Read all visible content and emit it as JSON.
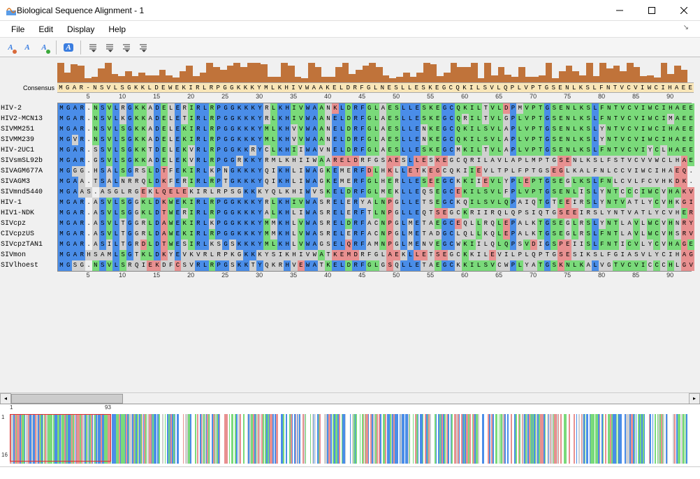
{
  "window": {
    "title": "Biological Sequence Alignment - 1"
  },
  "menu": {
    "file": "File",
    "edit": "Edit",
    "display": "Display",
    "help": "Help"
  },
  "ruler": {
    "ticks": [
      5,
      10,
      15,
      20,
      25,
      30,
      35,
      40,
      45,
      50,
      55,
      60,
      65,
      70,
      75,
      80,
      85,
      90
    ]
  },
  "consensus": {
    "label": "Consensus",
    "sequence": "MGAR-NSVLSGKKLDEWEKIRLRPGGKKKYMLKHIVWAAKELDRFGLNESLLESKEGCQKILSVLQPLVPTGSENLKSLFNTVCVIWCIHAEE"
  },
  "sequences": [
    {
      "name": "HIV-2",
      "seq": "MGAR.NSVLRGKKADELERIRLRPGGKKKYRLKHIVWAANKLDRFGLAESLLESKEGCQKILTVLDPMVPTGSENLKSLFNTVCVIWCIHAEE"
    },
    {
      "name": "HIV2-MCN13",
      "seq": "MGAR.NSVLKGKKADELETIRLRPGGKKKYRLKHIVWAANELDRFGLAESLLESKEGCQRILTVLGPLVPTGSENLKSLFNTVCVIWCIMAEE"
    },
    {
      "name": "SIVMM251",
      "seq": "MGAR.NSVLSGKKADELEKIRLRPGGKKKYMLKHVVWAANELDRFGLAESLLENKEGCQKILSVLAPLVPTGSENLKSLYNTVCVIWCIHAEE"
    },
    {
      "name": "SIVMM239",
      "seq": "MGVR.NSVLSGKKADELEKIRLRPGGKKKYMLKHVVWAANELDRFGLAESLLENKEGCQKILSVLAPLVPTGSENLKSLYNTVCVIWCIHAEE"
    },
    {
      "name": "HIV-2UC1",
      "seq": "MGAR.SSVLSGKKTDELEKVRLRPGGKKRYCLKHIIWAVNELDRFGLAESLLESKEGCMKILTVLAPLVPTGSENLKSLFNTVCVIYCLHAEE"
    },
    {
      "name": "SIVsmSL92b",
      "seq": "MGAR.GSVLSGKKADELEKVRLRPGGRKKYRMLKHIIWAARELDRFGSAESLLESKEGCQRILAVLAPLMPTGSENLKSLFSTVCVVWCLHAEM"
    },
    {
      "name": "SIVAGM677A",
      "seq": "MGGG.HSALSGRSLDTFEKIRLKPNGKKKYQIKHLIWAGKEMERFDLHKLLETKEGCQKIIEVLTPLFPTGSEGLKALFNLCCVIWCIHAEQ"
    },
    {
      "name": "SIVAGM3",
      "seq": "MGAA.TSALNRRQLDKFERIRLRPTGKKKYQIKHLIWAGKEMERFGLHERLLESEEGCKKIIEVLYPLEPTGSEGLKSLFNLCVLFCVHKDK"
    },
    {
      "name": "SIVmnd5440",
      "seq": "MGAAS.ASGLRGEKLQELEKIRLRPSGKKKYQLKHIWVSKELDRFGLMEKLLEQSEGCEKILSVLFPLVPTGSENLISLYNTCCCIWCVHAKV"
    },
    {
      "name": "HIV-1",
      "seq": "MGAR.ASVLSGGKLDKWEKIRLRPGGKKKYRLKHIVWASRELERYALNPGLLETSEGCKQILSVLQPAIQTGTEEIRSLYNTVATLYCVHKGI"
    },
    {
      "name": "HIV1-NDK",
      "seq": "MGAR.ASVLSGGKLDTWERIRLRPGGKKKYALKHLIWASRELERFTLNPGLLEQTSEGCKRIIRQLQPSIQTGSEEIRSLYNTVATLYCVHERI"
    },
    {
      "name": "SIVcpz",
      "seq": "MGAR.ASVLTGGRLDAWEKIRLKPGGKKKYMMKHLVWASRELDRFACNPGLMETAEGCEQLLRQLEPALKTGSEGLRSLYNTLAVLWCVHNRY"
    },
    {
      "name": "CIVcpzUS",
      "seq": "MGAR.ASVLTGGRLDAWEKIRLRPGGKKKYMMKHLVWASRELERFACNPGLMETADGCLQLLKQLEPALKTGSEGLRSLFNTLAVLWCVHSRV"
    },
    {
      "name": "SIVcpzTAN1",
      "seq": "MGAR.ASILTGRDLDTWESIRLKSGSKKKYMLKHLVWAGSELQRFAMNPGLMENVEGCWKIILQLQPSVDIGSPEIISLFNTICVLYCVHAGE"
    },
    {
      "name": "SIVmon",
      "seq": "MGARHSAMLSGTKLDKYEVKVRLRPKGKKKYSIKHIVWATKEMDRFGLAEKLLETSEGCKKILEVILPLQPTGSESIKSLFGIASVLYCIHAGI"
    },
    {
      "name": "SIVlhoest",
      "seq": "MGSG.NSVLSRQIEKDFCSVRLRPGSKKTYQKRHVEWATKELDRFGLGSQLLETAEGCKKILSVCWPLYATGSKNLKALVGTVCVICCCHLGV"
    }
  ],
  "overview": {
    "start_label": "1",
    "end_label": "93",
    "row_start": "1",
    "row_end": "16"
  },
  "consensus_heights": [
    28,
    14,
    26,
    24,
    6,
    8,
    20,
    28,
    12,
    9,
    16,
    9,
    14,
    10,
    10,
    18,
    10,
    7,
    16,
    24,
    9,
    14,
    28,
    22,
    18,
    24,
    28,
    22,
    28,
    28,
    26,
    8,
    8,
    28,
    24,
    8,
    6,
    28,
    22,
    8,
    8,
    22,
    28,
    12,
    18,
    24,
    28,
    22,
    10,
    6,
    8,
    14,
    8,
    14,
    28,
    26,
    9,
    14,
    28,
    22,
    22,
    28,
    6,
    28,
    10,
    22,
    11,
    8,
    22,
    8,
    8,
    10,
    28,
    6,
    16,
    24,
    16,
    10,
    28,
    9,
    28,
    20,
    24,
    16,
    28,
    22,
    9,
    10,
    7,
    28,
    12,
    24,
    18,
    10
  ]
}
